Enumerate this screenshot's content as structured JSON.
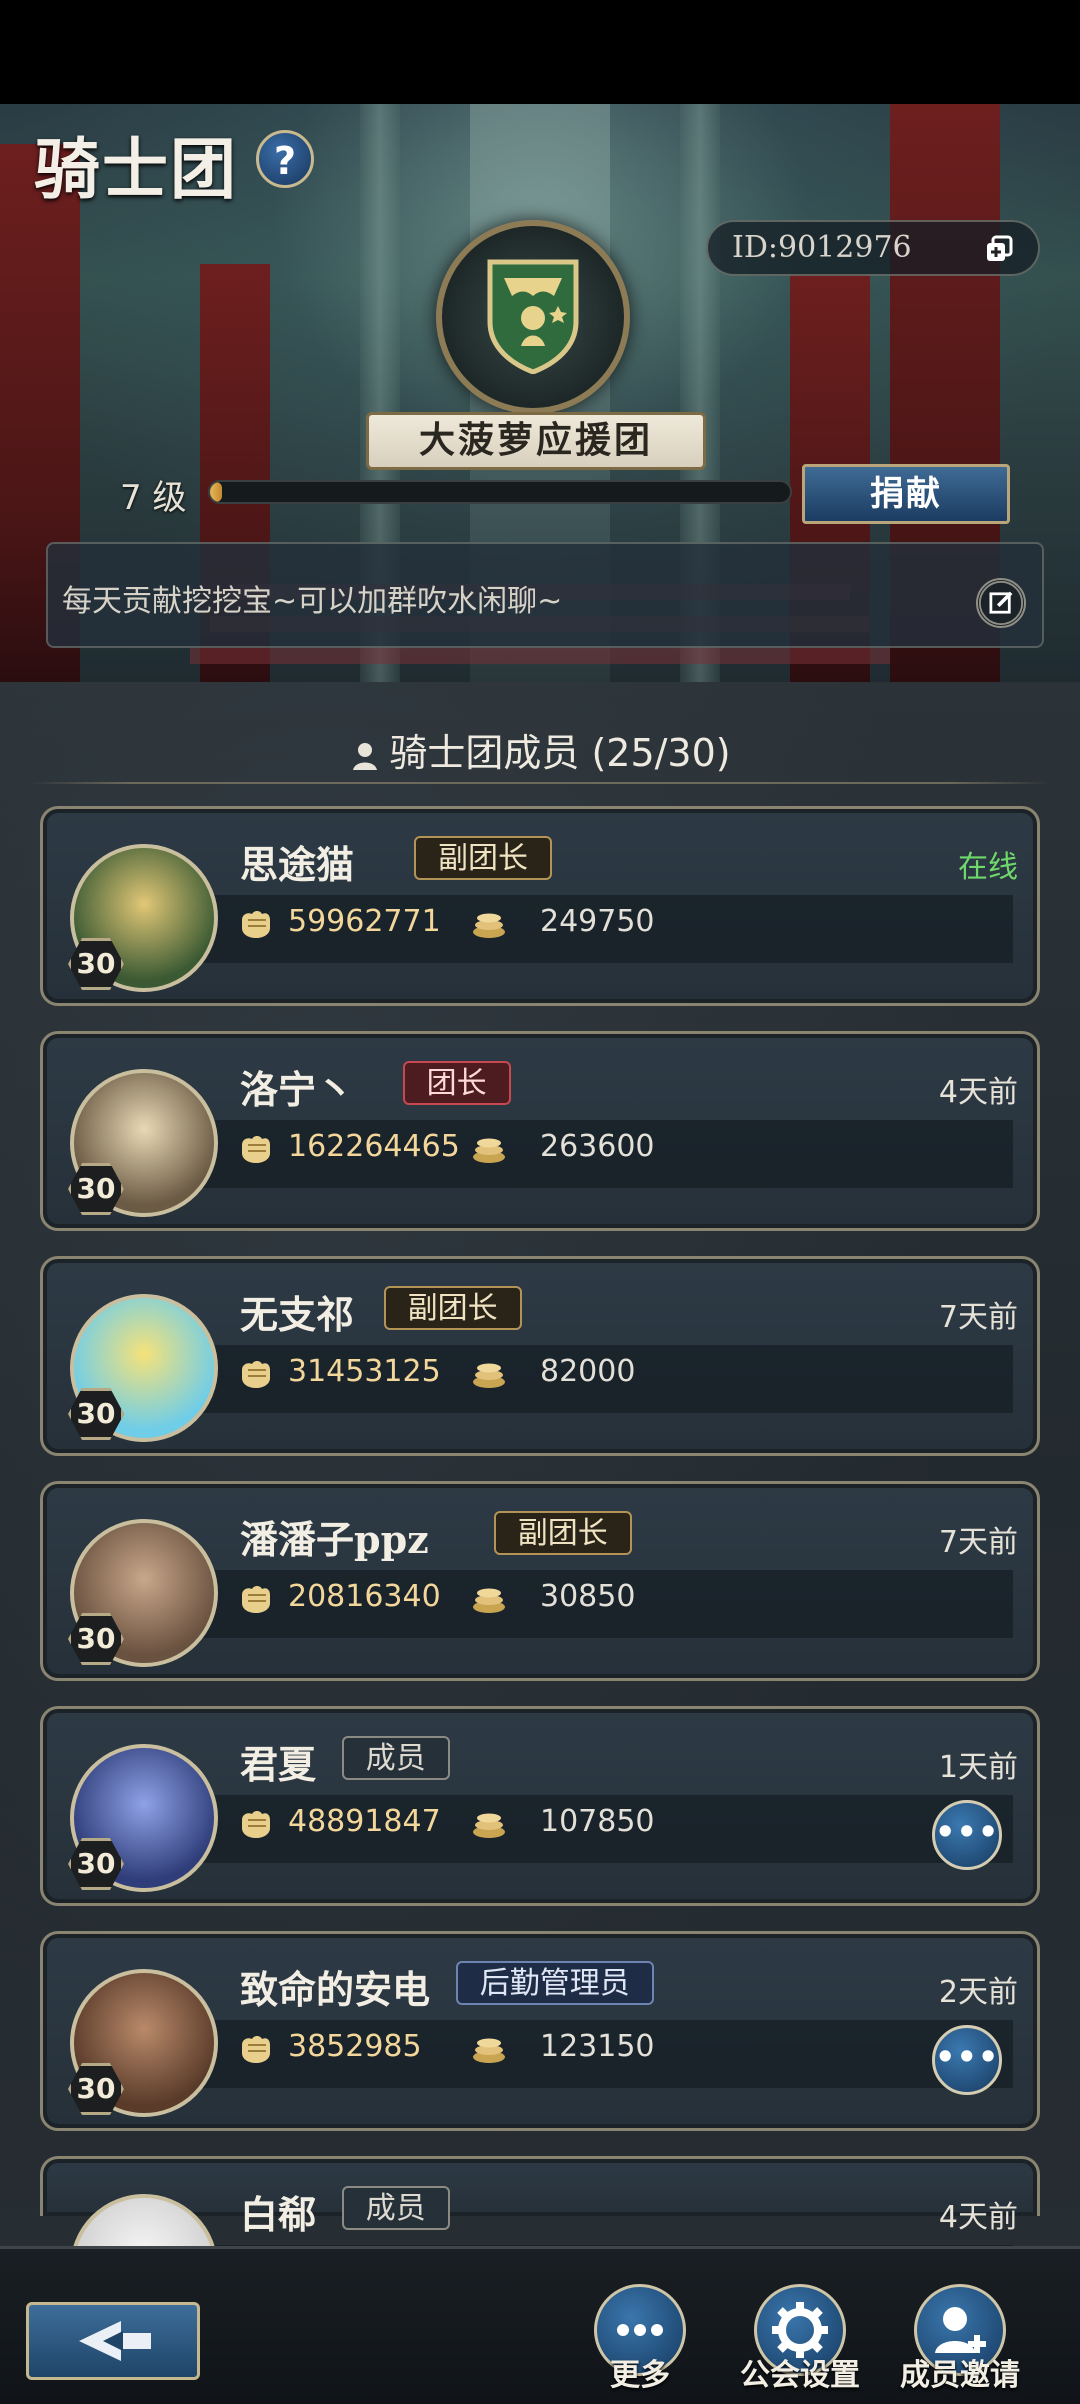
{
  "header": {
    "title": "骑士团",
    "help_label": "?",
    "guild_id": "ID:9012976",
    "guild_name": "大菠萝应援团",
    "level_text": "7  级",
    "level_progress": 0.02,
    "donate_label": "捐献",
    "notice": "每天贡献挖挖宝~可以加群吹水闲聊~"
  },
  "members_heading": "骑士团成员 (25/30)",
  "members": [
    {
      "name": "思途猫",
      "role": "副团长",
      "role_type": "vice",
      "status": "在线",
      "online": true,
      "level": "30",
      "power": "59962771",
      "contrib": "249750",
      "has_more": false
    },
    {
      "name": "洛宁丶",
      "role": "团长",
      "role_type": "leader",
      "status": "4天前",
      "online": false,
      "level": "30",
      "power": "162264465",
      "contrib": "263600",
      "has_more": false
    },
    {
      "name": "无支祁",
      "role": "副团长",
      "role_type": "vice",
      "status": "7天前",
      "online": false,
      "level": "30",
      "power": "31453125",
      "contrib": "82000",
      "has_more": false
    },
    {
      "name": "潘潘子ppz",
      "role": "副团长",
      "role_type": "vice",
      "status": "7天前",
      "online": false,
      "level": "30",
      "power": "20816340",
      "contrib": "30850",
      "has_more": false
    },
    {
      "name": "君夏",
      "role": "成员",
      "role_type": "member",
      "status": "1天前",
      "online": false,
      "level": "30",
      "power": "48891847",
      "contrib": "107850",
      "has_more": true
    },
    {
      "name": "致命的安电",
      "role": "后勤管理员",
      "role_type": "logi",
      "status": "2天前",
      "online": false,
      "level": "30",
      "power": "3852985",
      "contrib": "123150",
      "has_more": true
    },
    {
      "name": "白郗",
      "role": "成员",
      "role_type": "member",
      "status": "4天前",
      "online": false,
      "level": "",
      "power": "",
      "contrib": "",
      "has_more": false
    }
  ],
  "bottom_nav": {
    "more_label": "更多",
    "settings_label": "公会设置",
    "invite_label": "成员邀请"
  },
  "more_dots": "•••",
  "colors": {
    "online": "#6fd86b",
    "accent_gold": "#f3d79a",
    "button_blue": "#2b5a86"
  }
}
